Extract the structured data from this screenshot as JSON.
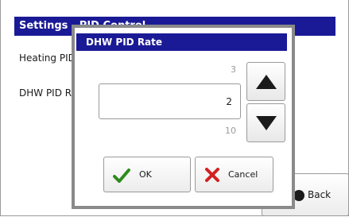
{
  "screen": {
    "title": "Settings - PID Control",
    "rows": [
      {
        "label": "Heating PID Rate"
      },
      {
        "label": "DHW PID Rate"
      }
    ],
    "back_label": "Back"
  },
  "dialog": {
    "title": "DHW PID Rate",
    "min_label": "3",
    "value": "2",
    "max_label": "10",
    "ok_label": "OK",
    "cancel_label": "Cancel"
  },
  "colors": {
    "title_bar": "#1a1a96",
    "ok_check": "#2e8b1e",
    "cancel_x": "#d42020"
  },
  "icons": {
    "increment": "triangle-up-icon",
    "decrement": "triangle-down-icon",
    "ok": "checkmark-icon",
    "cancel": "x-icon",
    "back": "back-arrow-icon"
  }
}
